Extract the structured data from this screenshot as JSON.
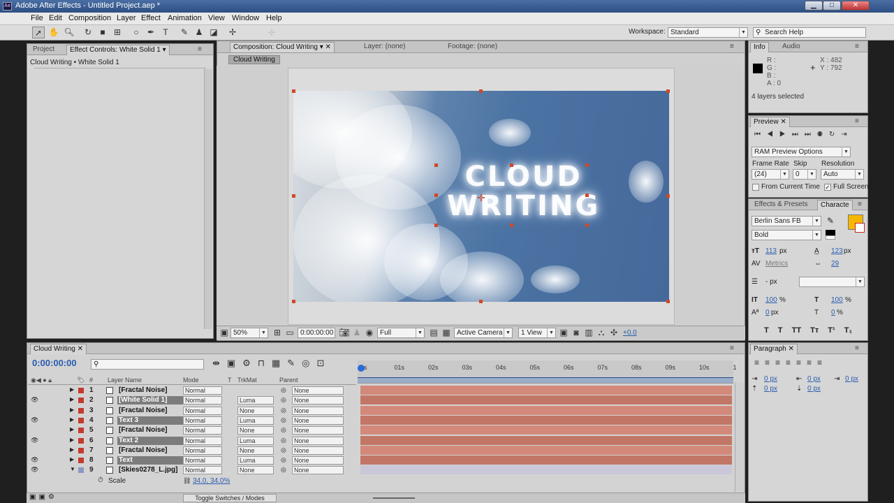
{
  "window": {
    "title": "Adobe After Effects - Untitled Project.aep *",
    "app_icon": "Ae"
  },
  "menu": [
    "File",
    "Edit",
    "Composition",
    "Layer",
    "Effect",
    "Animation",
    "View",
    "Window",
    "Help"
  ],
  "workspace": {
    "label": "Workspace:",
    "value": "Standard"
  },
  "search": {
    "placeholder": "Search Help"
  },
  "project_panel": {
    "tabs": [
      "Project",
      "Effect Controls: White Solid 1"
    ],
    "breadcrumb": "Cloud Writing • White Solid 1"
  },
  "comp_panel": {
    "tabs": [
      "Composition: Cloud Writing",
      "Layer: (none)",
      "Footage: (none)"
    ],
    "comp_button": "Cloud Writing",
    "footer": {
      "zoom": "50%",
      "timecode": "0:00:00:00",
      "resolution": "Full",
      "camera": "Active Camera",
      "views": "1 View",
      "exposure": "+0.0"
    },
    "frame_text": [
      "CLOUD",
      "WRITING"
    ]
  },
  "info_panel": {
    "tabs": [
      "Info",
      "Audio"
    ],
    "rgba": [
      "R :",
      "G :",
      "B :",
      "A : 0"
    ],
    "x": "X : 482",
    "y": "Y : 792",
    "status": "4 layers selected"
  },
  "preview_panel": {
    "title": "Preview",
    "mode": "RAM Preview Options",
    "frame_rate_label": "Frame Rate",
    "skip_label": "Skip",
    "resolution_label": "Resolution",
    "frame_rate": "(24)",
    "skip": "0",
    "resolution": "Auto",
    "from_current": "From Current Time",
    "full_screen": "Full Screen"
  },
  "character_panel": {
    "tabs": [
      "Effects & Presets",
      "Characte"
    ],
    "font": "Berlin Sans FB",
    "style": "Bold",
    "size": "113",
    "size_unit": "px",
    "leading": "123",
    "leading_unit": "px",
    "kerning": "Metrics",
    "tracking": "29",
    "stroke": "- px",
    "vscale": "100",
    "hscale": "100",
    "baseline": "0",
    "tsume": "0",
    "px": "px",
    "pct": "%",
    "fill_color": "#f5b800",
    "styles": [
      "T",
      "T",
      "TT",
      "Tт",
      "T¹",
      "T₁"
    ]
  },
  "paragraph_panel": {
    "title": "Paragraph",
    "indents": [
      "0 px",
      "0 px",
      "0 px",
      "0 px",
      "0 px"
    ]
  },
  "timeline": {
    "tab": "Cloud Writing",
    "time": "0:00:00:00",
    "headers": {
      "num": "#",
      "name": "Layer Name",
      "mode": "Mode",
      "t": "T",
      "trkmat": "TrkMat",
      "parent": "Parent"
    },
    "ruler": [
      "0s",
      "01s",
      "02s",
      "03s",
      "04s",
      "05s",
      "06s",
      "07s",
      "08s",
      "09s",
      "10s",
      "1"
    ],
    "layers": [
      {
        "num": "1",
        "name": "[Fractal Noise]",
        "mode": "Normal",
        "trkmat": "",
        "parent": "None",
        "eye": false,
        "hl": false
      },
      {
        "num": "2",
        "name": "[White Solid 1]",
        "mode": "Normal",
        "trkmat": "Luma",
        "parent": "None",
        "eye": true,
        "hl": true
      },
      {
        "num": "3",
        "name": "[Fractal Noise]",
        "mode": "Normal",
        "trkmat": "None",
        "parent": "None",
        "eye": false,
        "hl": false
      },
      {
        "num": "4",
        "name": "Text 3",
        "mode": "Normal",
        "trkmat": "Luma",
        "parent": "None",
        "eye": true,
        "hl": true
      },
      {
        "num": "5",
        "name": "[Fractal Noise]",
        "mode": "Normal",
        "trkmat": "None",
        "parent": "None",
        "eye": false,
        "hl": false
      },
      {
        "num": "6",
        "name": "Text 2",
        "mode": "Normal",
        "trkmat": "Luma",
        "parent": "None",
        "eye": true,
        "hl": true
      },
      {
        "num": "7",
        "name": "[Fractal Noise]",
        "mode": "Normal",
        "trkmat": "None",
        "parent": "None",
        "eye": false,
        "hl": false
      },
      {
        "num": "8",
        "name": "Text",
        "mode": "Normal",
        "trkmat": "Luma",
        "parent": "None",
        "eye": true,
        "hl": true
      },
      {
        "num": "9",
        "name": "[Skies0278_L.jpg]",
        "mode": "Normal",
        "trkmat": "None",
        "parent": "None",
        "eye": true,
        "hl": false
      }
    ],
    "scale_label": "Scale",
    "scale_value": "34.0, 34.0%",
    "toggle": "Toggle Switches / Modes"
  }
}
